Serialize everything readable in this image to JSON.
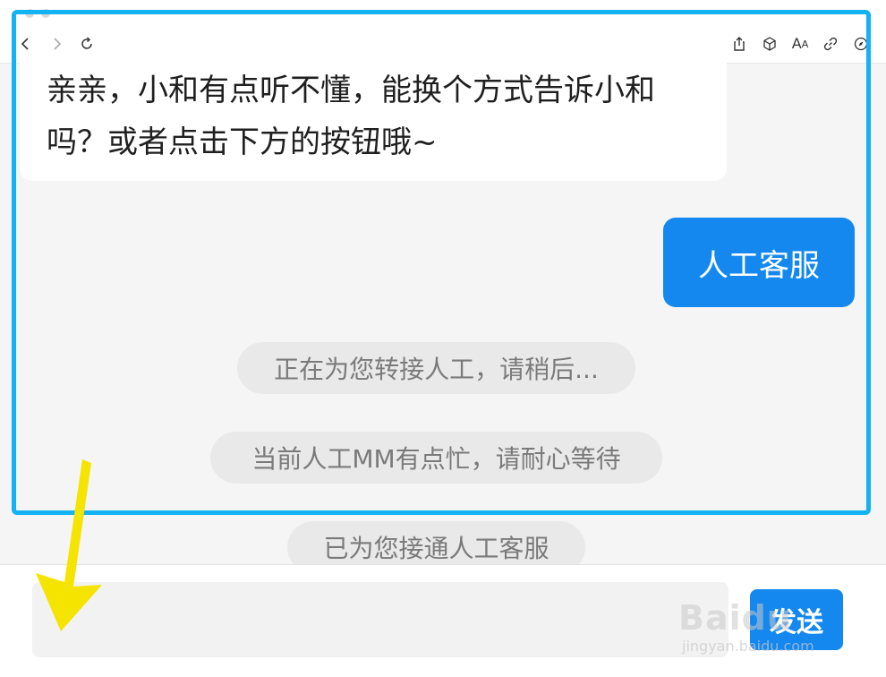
{
  "window": {
    "title": ""
  },
  "toolbar": {
    "back_icon": "chevron-left-icon",
    "forward_icon": "chevron-right-icon",
    "reload_icon": "reload-icon",
    "share_icon": "share-icon",
    "cube_icon": "cube-icon",
    "text_size_label": "A",
    "link_icon": "link-icon",
    "compass_icon": "compass-icon"
  },
  "chat": {
    "bot_message": "亲亲，小和有点听不懂，能换个方式告诉小和吗？或者点击下方的按钮哦~",
    "user_message": "人工客服",
    "system_messages": [
      "正在为您转接人工，请稍后...",
      "当前人工MM有点忙，请耐心等待",
      "已为您接通人工客服"
    ]
  },
  "input": {
    "value": "",
    "send_label": "发送"
  },
  "colors": {
    "accent": "#1488ee",
    "highlight": "#13b2f2",
    "annotation_arrow": "#f5e400"
  },
  "watermark": {
    "main": "Baidu",
    "sub": "jingyan.baidu.com"
  }
}
